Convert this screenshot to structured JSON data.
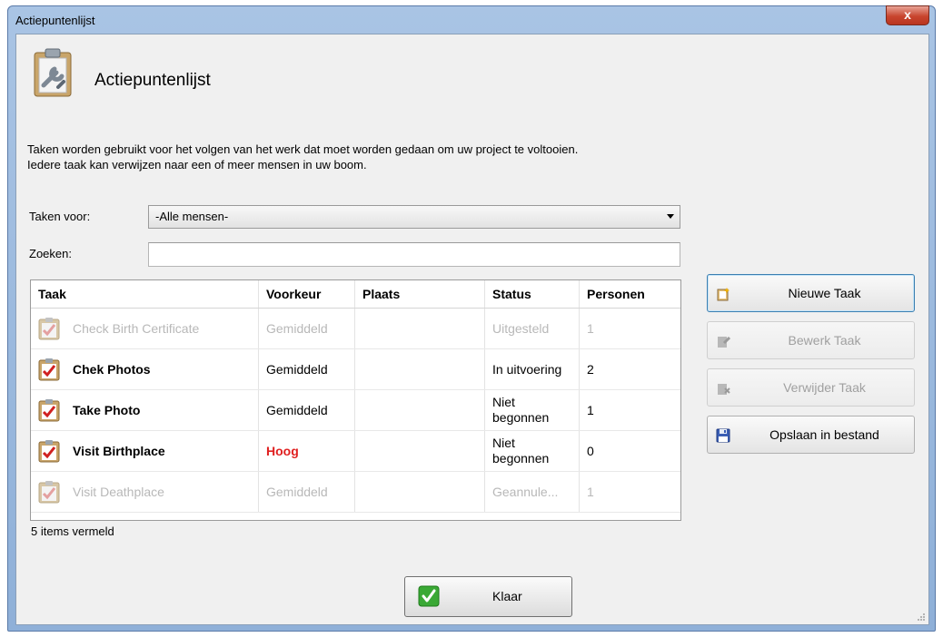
{
  "window": {
    "title": "Actiepuntenlijst",
    "close_glyph": "x"
  },
  "header": {
    "icon": "clipboard-wrench-icon",
    "title": "Actiepuntenlijst"
  },
  "intro": {
    "line1": "Taken worden gebruikt voor het volgen van het werk dat moet worden gedaan om uw project te voltooien.",
    "line2": "Iedere taak kan verwijzen naar een of meer mensen in uw boom."
  },
  "filter": {
    "label": "Taken voor:",
    "selected": "-Alle mensen-"
  },
  "search": {
    "label": "Zoeken:",
    "value": "",
    "placeholder": ""
  },
  "table": {
    "columns": [
      "Taak",
      "Voorkeur",
      "Plaats",
      "Status",
      "Personen"
    ],
    "rows": [
      {
        "taak": "Check Birth Certificate",
        "voorkeur": "Gemiddeld",
        "plaats": "",
        "status": "Uitgesteld",
        "personen": "1",
        "style": "disabled"
      },
      {
        "taak": "Chek Photos",
        "voorkeur": "Gemiddeld",
        "plaats": "",
        "status": "In uitvoering",
        "personen": "2",
        "style": "bold"
      },
      {
        "taak": "Take Photo",
        "voorkeur": "Gemiddeld",
        "plaats": "",
        "status": "Niet begonnen",
        "personen": "1",
        "style": "bold"
      },
      {
        "taak": "Visit Birthplace",
        "voorkeur": "Hoog",
        "plaats": "",
        "status": "Niet begonnen",
        "personen": "0",
        "style": "bold"
      },
      {
        "taak": "Visit Deathplace",
        "voorkeur": "Gemiddeld",
        "plaats": "",
        "status": "Geannule...",
        "personen": "1",
        "style": "disabled"
      }
    ]
  },
  "status": {
    "count_text": "5 items vermeld"
  },
  "buttons": {
    "new_task": "Nieuwe Taak",
    "edit_task": "Bewerk Taak",
    "delete_task": "Verwijder Taak",
    "save_file": "Opslaan in bestand",
    "done": "Klaar"
  },
  "colors": {
    "high_priority": "#e02020",
    "disabled_text": "#b8b8b8",
    "titlebar": "#a9c4e4",
    "accent_border": "#3c7fb1"
  }
}
